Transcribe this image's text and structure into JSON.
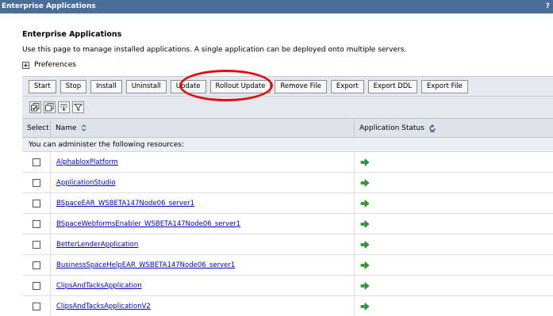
{
  "title_bar": {
    "title": "Enterprise Applications",
    "help": "?"
  },
  "page": {
    "heading": "Enterprise Applications",
    "description": "Use this page to manage installed applications. A single application can be deployed onto multiple servers.",
    "preferences_label": "Preferences"
  },
  "toolbar": {
    "buttons": [
      {
        "label": "Start"
      },
      {
        "label": "Stop"
      },
      {
        "label": "Install"
      },
      {
        "label": "Uninstall"
      },
      {
        "label": "Update"
      },
      {
        "label": "Rollout Update"
      },
      {
        "label": "Remove File"
      },
      {
        "label": "Export"
      },
      {
        "label": "Export DDL"
      },
      {
        "label": "Export File"
      }
    ]
  },
  "icon_toolbar": {
    "icons": [
      "select-all-icon",
      "deselect-all-icon",
      "show-filter-icon",
      "clear-filter-icon"
    ]
  },
  "table": {
    "columns": {
      "select": "Select",
      "name": "Name",
      "status": "Application Status"
    },
    "note": "You can administer the following resources:",
    "rows": [
      {
        "name": "AlphabloxPlatform"
      },
      {
        "name": "ApplicationStudio"
      },
      {
        "name": "BSpaceEAR_WSBETA147Node06_server1"
      },
      {
        "name": "BSpaceWebformsEnabler_WSBETA147Node06_server1"
      },
      {
        "name": "BetterLenderApplication"
      },
      {
        "name": "BusinessSpaceHelpEAR_WSBETA147Node06_server1"
      },
      {
        "name": "ClipsAndTacksApplication"
      },
      {
        "name": "ClipsAndTacksApplicationV2"
      }
    ]
  },
  "colors": {
    "title_bar": "#4a6d99",
    "toolbar_bg": "#e5e9ef",
    "link": "#0000cc",
    "status_arrow": "#2e9e2e",
    "highlight_circle": "#dd1111"
  }
}
